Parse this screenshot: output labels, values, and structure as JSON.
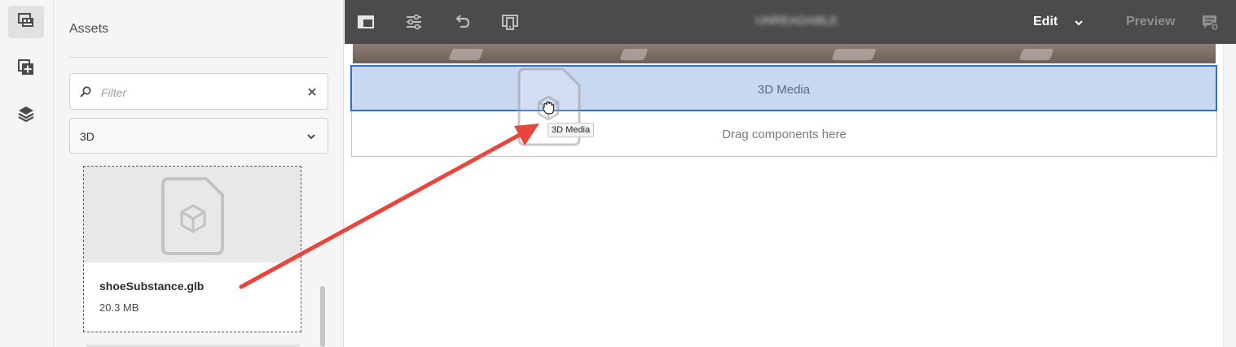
{
  "rail": {
    "items": [
      {
        "name": "assets",
        "icon": "assets-icon",
        "active": true
      },
      {
        "name": "components",
        "icon": "add-components-icon",
        "active": false
      },
      {
        "name": "content-tree",
        "icon": "layers-icon",
        "active": false
      }
    ]
  },
  "panel": {
    "title": "Assets",
    "filter": {
      "placeholder": "Filter",
      "value": ""
    },
    "asset_type": {
      "selected": "3D"
    },
    "assets": [
      {
        "name": "shoeSubstance.glb",
        "size": "20.3 MB",
        "icon": "3d-file-icon"
      }
    ]
  },
  "toolbar": {
    "page_title": "UNREADABLE",
    "mode": "Edit",
    "preview_label": "Preview"
  },
  "canvas": {
    "component_label": "3D Media",
    "drop_placeholder": "Drag components here",
    "drag_tooltip": "3D Media"
  },
  "colors": {
    "toolbar_bg": "#4b4b4b",
    "selection_fill": "#c8d8f1",
    "selection_border": "#2d6fd1",
    "arrow": "#e8463c"
  }
}
